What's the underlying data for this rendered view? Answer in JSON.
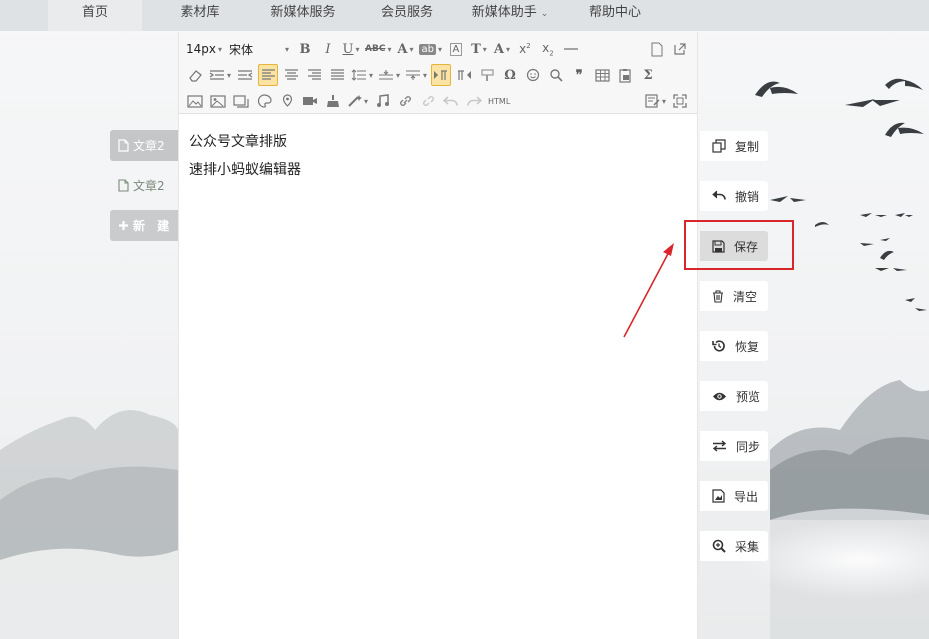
{
  "nav": {
    "items": [
      {
        "label": "首页",
        "active": true
      },
      {
        "label": "素材库"
      },
      {
        "label": "新媒体服务"
      },
      {
        "label": "会员服务"
      },
      {
        "label": "新媒体助手"
      },
      {
        "label": "帮助中心"
      }
    ],
    "caret": "⌄"
  },
  "articles": {
    "items": [
      {
        "label": "文章2"
      },
      {
        "label": "文章2"
      }
    ],
    "new_label": "新 建"
  },
  "toolbar": {
    "font_size": "14px",
    "font_name": "宋体",
    "bold": "B",
    "italic": "I",
    "underline": "U",
    "strike": "ABC",
    "font_color": "A",
    "highlight": "ab",
    "box_a": "A",
    "title_t": "T",
    "case_a": "A",
    "html_label": "HTML",
    "omega": "Ω",
    "quote": "❞",
    "sigma": "Σ"
  },
  "editor": {
    "lines": [
      "公众号文章排版",
      "速排小蚂蚁编辑器"
    ]
  },
  "actions": {
    "items": [
      {
        "label": "复制",
        "icon": "copy-icon"
      },
      {
        "label": "撤销",
        "icon": "undo-icon"
      },
      {
        "label": "保存",
        "icon": "save-icon",
        "highlighted": true
      },
      {
        "label": "清空",
        "icon": "trash-icon"
      },
      {
        "label": "恢复",
        "icon": "restore-icon"
      },
      {
        "label": "预览",
        "icon": "eye-icon"
      },
      {
        "label": "同步",
        "icon": "sync-icon"
      },
      {
        "label": "导出",
        "icon": "export-icon"
      },
      {
        "label": "采集",
        "icon": "zoom-in-icon"
      }
    ]
  },
  "colors": {
    "nav_bg": "#dfe2e5",
    "accent_highlight": "#fbe3a3",
    "annotation_red": "#d7262c"
  }
}
